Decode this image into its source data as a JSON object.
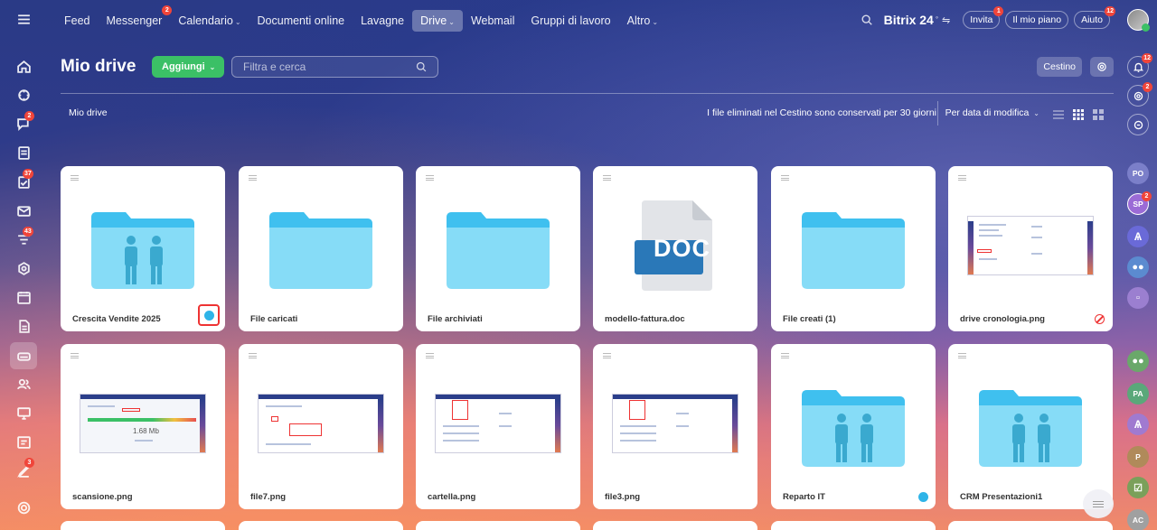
{
  "app": {
    "brand": "Bitrix 24"
  },
  "topnav": {
    "items": [
      {
        "label": "Feed"
      },
      {
        "label": "Messenger",
        "badge": "2"
      },
      {
        "label": "Calendario",
        "dropdown": true
      },
      {
        "label": "Documenti online"
      },
      {
        "label": "Lavagne"
      },
      {
        "label": "Drive",
        "dropdown": true,
        "active": true
      },
      {
        "label": "Webmail"
      },
      {
        "label": "Gruppi di lavoro"
      },
      {
        "label": "Altro",
        "dropdown": true
      }
    ],
    "invite_label": "Invita",
    "invite_badge": "1",
    "plan_label": "Il mio piano",
    "help_label": "Aiuto",
    "help_badge": "12"
  },
  "leftbar": {
    "badges": {
      "chat": "2",
      "tasks": "37",
      "feed": "43",
      "signature": "3"
    }
  },
  "rightbar": {
    "bell_badge": "12",
    "copilot_badge": "2",
    "avatars": [
      {
        "initials": "PO",
        "color": "#7b7fc9"
      },
      {
        "initials": "SP",
        "color": "#9b6bd6",
        "badge": "2"
      },
      {
        "initials": "",
        "color": "#6a6ad8"
      },
      {
        "initials": "",
        "color": "#5b8bd0"
      },
      {
        "initials": "",
        "color": "#9b7fd0"
      },
      {
        "initials": "",
        "color": "#6aa86a"
      },
      {
        "initials": "PA",
        "color": "#5aa87a"
      },
      {
        "initials": "",
        "color": "#a07ad0"
      },
      {
        "initials": "P",
        "color": "#b08a5a"
      },
      {
        "initials": "",
        "color": "#7aa05a"
      },
      {
        "initials": "AC",
        "color": "#a0a0a0"
      }
    ]
  },
  "page": {
    "title": "Mio drive",
    "add_label": "Aggiungi",
    "search_placeholder": "Filtra e cerca",
    "trash_label": "Cestino",
    "breadcrumb": "Mio drive",
    "notice": "I file eliminati nel Cestino sono conservati per 30 giorni",
    "sort_label": "Per data di modifica"
  },
  "files": [
    {
      "name": "Crescita Vendite 2025",
      "type": "group-folder",
      "mark": "shared-highlight"
    },
    {
      "name": "File caricati",
      "type": "folder"
    },
    {
      "name": "File archiviati",
      "type": "folder"
    },
    {
      "name": "modello-fattura.doc",
      "type": "doc",
      "doc_label": "DOC"
    },
    {
      "name": "File creati (1)",
      "type": "folder"
    },
    {
      "name": "drive cronologia.png",
      "type": "image",
      "mark": "blocked"
    },
    {
      "name": "scansione.png",
      "type": "image",
      "preview_text": "1.68 Mb"
    },
    {
      "name": "file7.png",
      "type": "image"
    },
    {
      "name": "cartella.png",
      "type": "image"
    },
    {
      "name": "file3.png",
      "type": "image"
    },
    {
      "name": "Reparto IT",
      "type": "group-folder",
      "mark": "shared"
    },
    {
      "name": "CRM Presentazioni1",
      "type": "group-folder"
    }
  ],
  "colors": {
    "accent_green": "#3bc066",
    "folder": "#86dcf7",
    "folder_tab": "#3fc0ef",
    "badge_red": "#f0453a"
  }
}
